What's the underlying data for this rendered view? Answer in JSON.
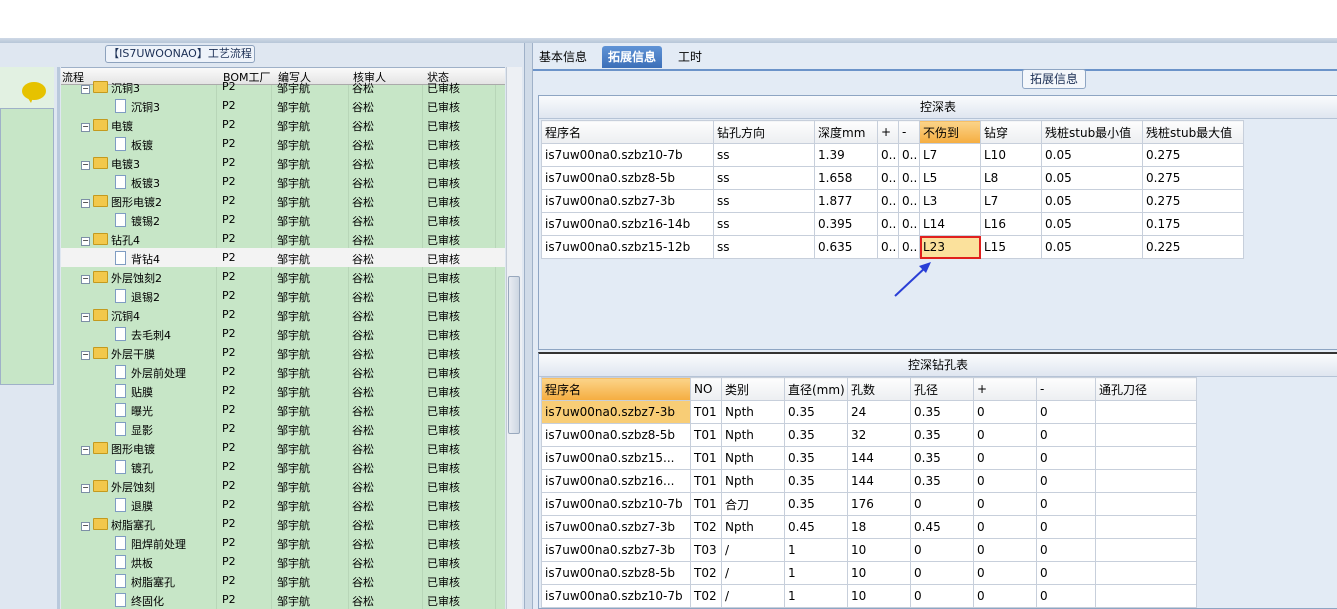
{
  "left": {
    "group_label": "【IS7UWOONAO】工艺流程",
    "columns": [
      "流程",
      "BOM工厂",
      "编写人",
      "核审人",
      "状态"
    ],
    "rows": [
      {
        "indent": 1,
        "type": "folder",
        "name": "沉铜3",
        "bom": "P2",
        "author": "邹宇航",
        "reviewer": "谷松",
        "status": "已审核"
      },
      {
        "indent": 2,
        "type": "item",
        "name": "沉铜3",
        "bom": "P2",
        "author": "邹宇航",
        "reviewer": "谷松",
        "status": "已审核"
      },
      {
        "indent": 1,
        "type": "folder",
        "name": "电镀",
        "bom": "P2",
        "author": "邹宇航",
        "reviewer": "谷松",
        "status": "已审核"
      },
      {
        "indent": 2,
        "type": "item",
        "name": "板镀",
        "bom": "P2",
        "author": "邹宇航",
        "reviewer": "谷松",
        "status": "已审核"
      },
      {
        "indent": 1,
        "type": "folder",
        "name": "电镀3",
        "bom": "P2",
        "author": "邹宇航",
        "reviewer": "谷松",
        "status": "已审核"
      },
      {
        "indent": 2,
        "type": "item",
        "name": "板镀3",
        "bom": "P2",
        "author": "邹宇航",
        "reviewer": "谷松",
        "status": "已审核"
      },
      {
        "indent": 1,
        "type": "folder",
        "name": "图形电镀2",
        "bom": "P2",
        "author": "邹宇航",
        "reviewer": "谷松",
        "status": "已审核"
      },
      {
        "indent": 2,
        "type": "item",
        "name": "镀锡2",
        "bom": "P2",
        "author": "邹宇航",
        "reviewer": "谷松",
        "status": "已审核"
      },
      {
        "indent": 1,
        "type": "folder",
        "name": "钻孔4",
        "bom": "P2",
        "author": "邹宇航",
        "reviewer": "谷松",
        "status": "已审核"
      },
      {
        "indent": 2,
        "type": "item",
        "name": "背钻4",
        "bom": "P2",
        "author": "邹宇航",
        "reviewer": "谷松",
        "status": "已审核",
        "selected": true
      },
      {
        "indent": 1,
        "type": "folder",
        "name": "外层蚀刻2",
        "bom": "P2",
        "author": "邹宇航",
        "reviewer": "谷松",
        "status": "已审核"
      },
      {
        "indent": 2,
        "type": "item",
        "name": "退锡2",
        "bom": "P2",
        "author": "邹宇航",
        "reviewer": "谷松",
        "status": "已审核"
      },
      {
        "indent": 1,
        "type": "folder",
        "name": "沉铜4",
        "bom": "P2",
        "author": "邹宇航",
        "reviewer": "谷松",
        "status": "已审核"
      },
      {
        "indent": 2,
        "type": "item",
        "name": "去毛刺4",
        "bom": "P2",
        "author": "邹宇航",
        "reviewer": "谷松",
        "status": "已审核"
      },
      {
        "indent": 1,
        "type": "folder",
        "name": "外层干膜",
        "bom": "P2",
        "author": "邹宇航",
        "reviewer": "谷松",
        "status": "已审核"
      },
      {
        "indent": 2,
        "type": "item",
        "name": "外层前处理",
        "bom": "P2",
        "author": "邹宇航",
        "reviewer": "谷松",
        "status": "已审核"
      },
      {
        "indent": 2,
        "type": "item",
        "name": "贴膜",
        "bom": "P2",
        "author": "邹宇航",
        "reviewer": "谷松",
        "status": "已审核"
      },
      {
        "indent": 2,
        "type": "item",
        "name": "曝光",
        "bom": "P2",
        "author": "邹宇航",
        "reviewer": "谷松",
        "status": "已审核"
      },
      {
        "indent": 2,
        "type": "item",
        "name": "显影",
        "bom": "P2",
        "author": "邹宇航",
        "reviewer": "谷松",
        "status": "已审核"
      },
      {
        "indent": 1,
        "type": "folder",
        "name": "图形电镀",
        "bom": "P2",
        "author": "邹宇航",
        "reviewer": "谷松",
        "status": "已审核"
      },
      {
        "indent": 2,
        "type": "item",
        "name": "镀孔",
        "bom": "P2",
        "author": "邹宇航",
        "reviewer": "谷松",
        "status": "已审核"
      },
      {
        "indent": 1,
        "type": "folder",
        "name": "外层蚀刻",
        "bom": "P2",
        "author": "邹宇航",
        "reviewer": "谷松",
        "status": "已审核"
      },
      {
        "indent": 2,
        "type": "item",
        "name": "退膜",
        "bom": "P2",
        "author": "邹宇航",
        "reviewer": "谷松",
        "status": "已审核"
      },
      {
        "indent": 1,
        "type": "folder",
        "name": "树脂塞孔",
        "bom": "P2",
        "author": "邹宇航",
        "reviewer": "谷松",
        "status": "已审核"
      },
      {
        "indent": 2,
        "type": "item",
        "name": "阻焊前处理",
        "bom": "P2",
        "author": "邹宇航",
        "reviewer": "谷松",
        "status": "已审核"
      },
      {
        "indent": 2,
        "type": "item",
        "name": "烘板",
        "bom": "P2",
        "author": "邹宇航",
        "reviewer": "谷松",
        "status": "已审核"
      },
      {
        "indent": 2,
        "type": "item",
        "name": "树脂塞孔",
        "bom": "P2",
        "author": "邹宇航",
        "reviewer": "谷松",
        "status": "已审核"
      },
      {
        "indent": 2,
        "type": "item",
        "name": "终固化",
        "bom": "P2",
        "author": "邹宇航",
        "reviewer": "谷松",
        "status": "已审核"
      }
    ]
  },
  "right": {
    "tabs": [
      "基本信息",
      "拓展信息",
      "工时"
    ],
    "active_tab": 1,
    "section_label": "拓展信息",
    "table1": {
      "title": "控深表",
      "columns": [
        "程序名",
        "钻孔方向",
        "深度mm",
        "+",
        "-",
        "不伤到",
        "钻穿",
        "残桩stub最小值",
        "残桩stub最大值"
      ],
      "rows": [
        [
          "is7uw00na0.szbz10-7b",
          "ss",
          "1.39",
          "0..",
          "0..",
          "L7",
          "L10",
          "0.05",
          "0.275"
        ],
        [
          "is7uw00na0.szbz8-5b",
          "ss",
          "1.658",
          "0..",
          "0..",
          "L5",
          "L8",
          "0.05",
          "0.275"
        ],
        [
          "is7uw00na0.szbz7-3b",
          "ss",
          "1.877",
          "0..",
          "0..",
          "L3",
          "L7",
          "0.05",
          "0.275"
        ],
        [
          "is7uw00na0.szbz16-14b",
          "ss",
          "0.395",
          "0..",
          "0..",
          "L14",
          "L16",
          "0.05",
          "0.175"
        ],
        [
          "is7uw00na0.szbz15-12b",
          "ss",
          "0.635",
          "0..",
          "0..",
          "L23",
          "L15",
          "0.05",
          "0.225"
        ]
      ]
    },
    "table2": {
      "title": "控深钻孔表",
      "columns": [
        "程序名",
        "NO",
        "类别",
        "直径(mm)",
        "孔数",
        "孔径",
        "+",
        "-",
        "通孔刀径"
      ],
      "rows": [
        [
          "is7uw00na0.szbz7-3b",
          "T01",
          "Npth",
          "0.35",
          "24",
          "0.35",
          "0",
          "0",
          ""
        ],
        [
          "is7uw00na0.szbz8-5b",
          "T01",
          "Npth",
          "0.35",
          "32",
          "0.35",
          "0",
          "0",
          ""
        ],
        [
          "is7uw00na0.szbz15...",
          "T01",
          "Npth",
          "0.35",
          "144",
          "0.35",
          "0",
          "0",
          ""
        ],
        [
          "is7uw00na0.szbz16...",
          "T01",
          "Npth",
          "0.35",
          "144",
          "0.35",
          "0",
          "0",
          ""
        ],
        [
          "is7uw00na0.szbz10-7b",
          "T01",
          "合刀",
          "0.35",
          "176",
          "0",
          "0",
          "0",
          ""
        ],
        [
          "is7uw00na0.szbz7-3b",
          "T02",
          "Npth",
          "0.45",
          "18",
          "0.45",
          "0",
          "0",
          ""
        ],
        [
          "is7uw00na0.szbz7-3b",
          "T03",
          "/",
          "1",
          "10",
          "0",
          "0",
          "0",
          ""
        ],
        [
          "is7uw00na0.szbz8-5b",
          "T02",
          "/",
          "1",
          "10",
          "0",
          "0",
          "0",
          ""
        ],
        [
          "is7uw00na0.szbz10-7b",
          "T02",
          "/",
          "1",
          "10",
          "0",
          "0",
          "0",
          ""
        ]
      ]
    }
  },
  "colors": {
    "tree_bg": "#c7e6c7",
    "tab_active": "#3c6fb8",
    "highlight_header": "#f5ad40",
    "mark_border": "#e0201d",
    "arrow": "#2a3fd6"
  }
}
